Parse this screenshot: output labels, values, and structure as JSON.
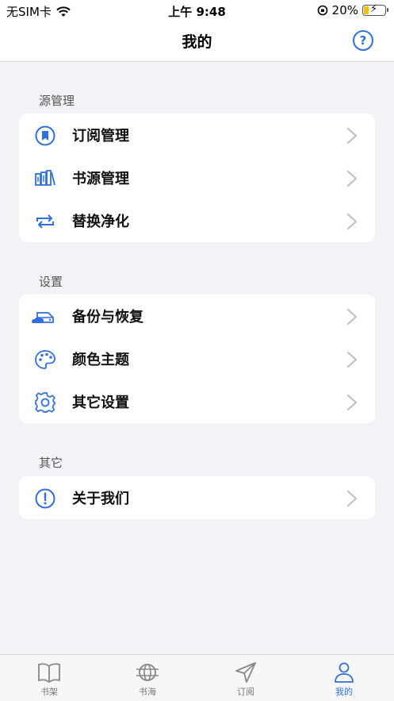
{
  "status": {
    "carrier": "无SIM卡",
    "time": "上午 9:48",
    "battery": "20%"
  },
  "nav": {
    "title": "我的",
    "help": "?"
  },
  "sections": [
    {
      "title": "源管理",
      "items": [
        {
          "label": "订阅管理",
          "icon": "bookmark-icon"
        },
        {
          "label": "书源管理",
          "icon": "books-icon"
        },
        {
          "label": "替换净化",
          "icon": "swap-icon"
        }
      ]
    },
    {
      "title": "设置",
      "items": [
        {
          "label": "备份与恢复",
          "icon": "cloud-drive-icon"
        },
        {
          "label": "颜色主题",
          "icon": "palette-icon"
        },
        {
          "label": "其它设置",
          "icon": "gear-icon"
        }
      ]
    },
    {
      "title": "其它",
      "items": [
        {
          "label": "关于我们",
          "icon": "info-icon"
        }
      ]
    }
  ],
  "tabs": [
    {
      "label": "书架",
      "icon": "book-icon",
      "active": false
    },
    {
      "label": "书海",
      "icon": "globe-icon",
      "active": false
    },
    {
      "label": "订阅",
      "icon": "send-icon",
      "active": false
    },
    {
      "label": "我的",
      "icon": "person-icon",
      "active": true
    }
  ],
  "colors": {
    "accent": "#2f6fe0",
    "background": "#f2f2f7"
  }
}
